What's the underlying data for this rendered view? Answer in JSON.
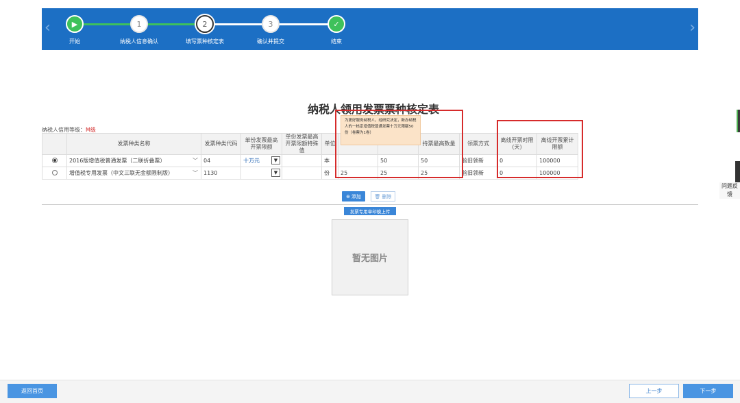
{
  "stepper": {
    "steps": [
      {
        "marker": "▶",
        "label": "开始",
        "state": "done"
      },
      {
        "marker": "1",
        "label": "纳税人信息确认",
        "state": "todo"
      },
      {
        "marker": "2",
        "label": "填写票种核定表",
        "state": "active"
      },
      {
        "marker": "3",
        "label": "确认并提交",
        "state": "todo"
      },
      {
        "marker": "✓",
        "label": "结束",
        "state": "done"
      }
    ],
    "prev_icon": "chevron-left-icon",
    "next_icon": "chevron-right-icon",
    "colors": {
      "banner": "#1c6fc4",
      "done": "#3ec15b"
    }
  },
  "page": {
    "title": "纳税人领用发票票种核定表",
    "credit_label": "纳税人信用等级：",
    "credit_level": "M级"
  },
  "table": {
    "headers": [
      "",
      "发票种类名称",
      "发票种类代码",
      "单份发票最高开票限额",
      "单份发票最高开票限额特殊值",
      "单位",
      "",
      "",
      "持票最高数量",
      "领票方式",
      "离线开票时限(天)",
      "离线开票累计限额"
    ],
    "rows": [
      {
        "selected": true,
        "name": "2016版增值税普通发票（二联折叠票）",
        "code": "04",
        "limit": "十万元",
        "special": "",
        "unit": "本",
        "c6": "",
        "c7": "50",
        "max_hold": "50",
        "method": "验旧领新",
        "offline_days": "0",
        "offline_limit": "100000"
      },
      {
        "selected": false,
        "name": "增值税专用发票（中文三联无金额限制版）",
        "code": "1130",
        "limit": "",
        "special": "",
        "unit": "份",
        "c6": "25",
        "c7": "25",
        "max_hold": "25",
        "method": "验旧领新",
        "offline_days": "0",
        "offline_limit": "100000"
      }
    ]
  },
  "tooltip": {
    "text": "为更好服务纳税人，经研究决定，新办纳税人的一核定增值税普通发票十万元限额50份（卷票为1卷）"
  },
  "actions": {
    "add_label": "添加",
    "delete_label": "删除",
    "upload_label": "发票专用章印模上传",
    "no_image": "暂无图片"
  },
  "side": {
    "feedback": "问题反馈"
  },
  "footer": {
    "home_label": "返回首页",
    "prev_label": "上一步",
    "next_label": "下一步"
  }
}
